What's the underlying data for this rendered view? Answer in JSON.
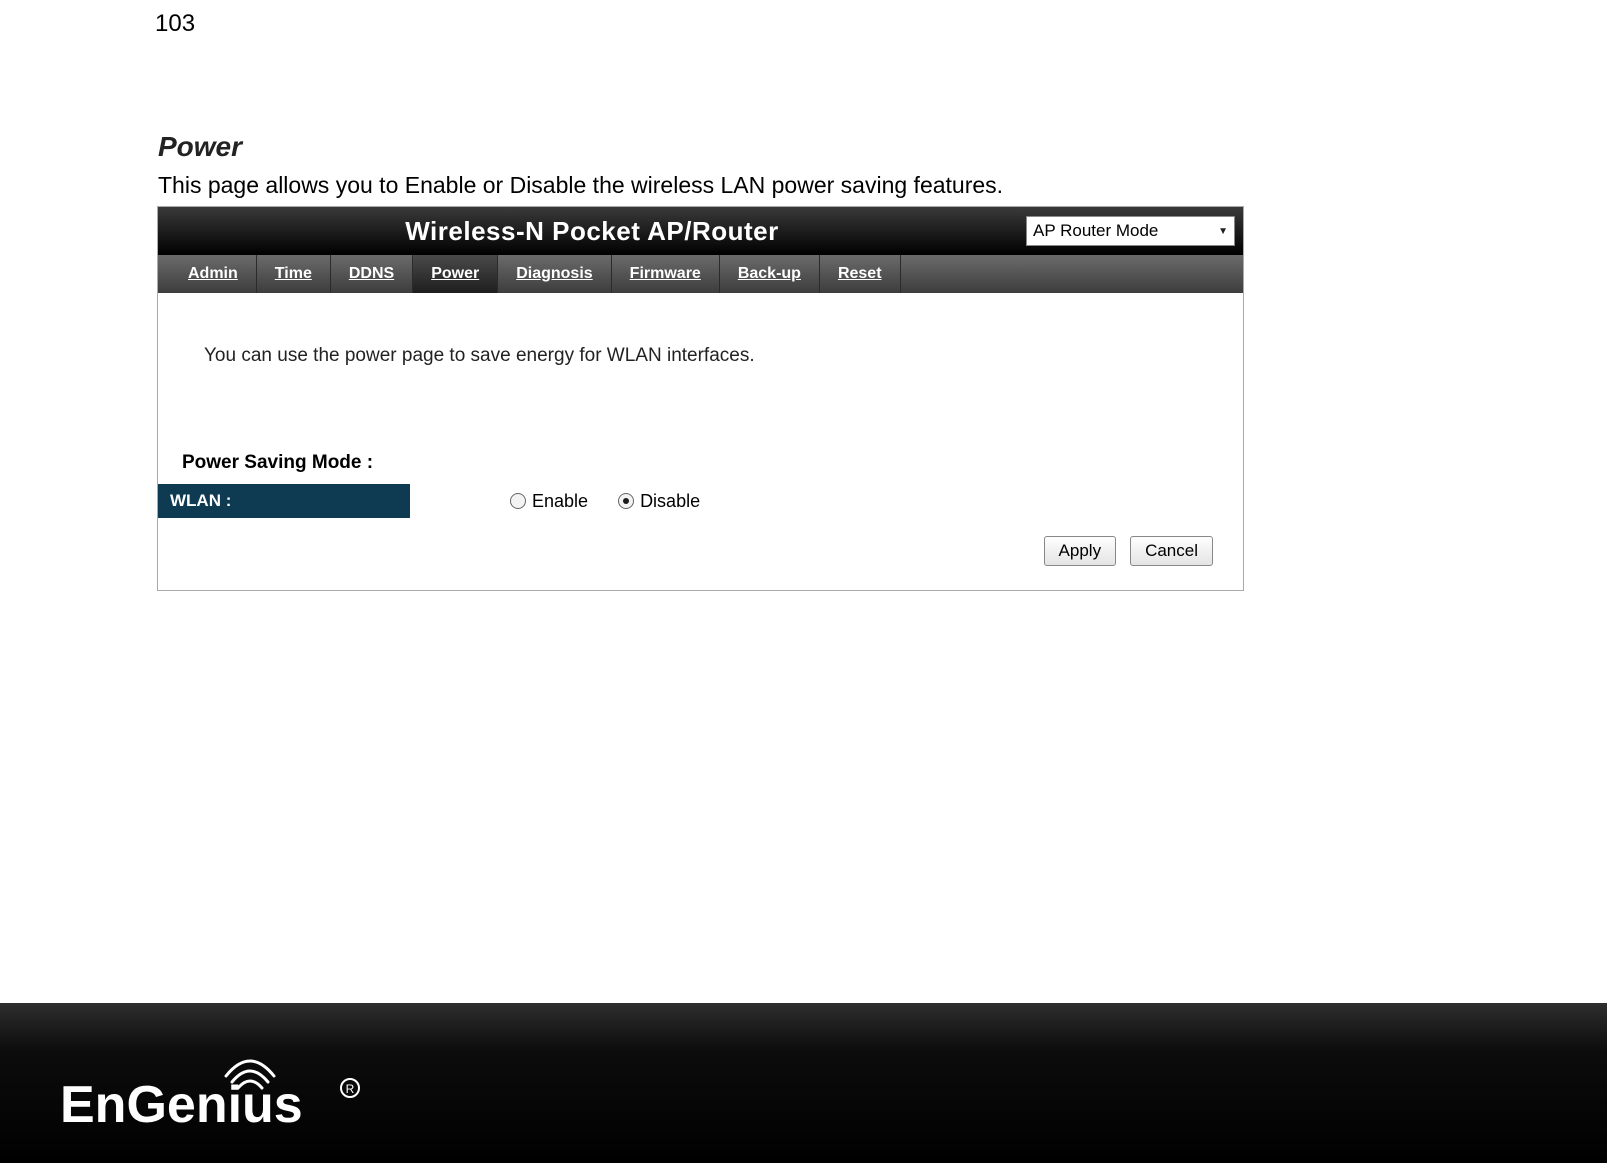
{
  "page_number": "103",
  "section": {
    "title": "Power",
    "description": "This page allows you to Enable or Disable the wireless LAN power saving features."
  },
  "router": {
    "title": "Wireless-N Pocket AP/Router",
    "mode_select": {
      "selected": "AP Router Mode"
    },
    "tabs": {
      "admin": "Admin",
      "time": "Time",
      "ddns": "DDNS",
      "power": "Power",
      "diagnosis": "Diagnosis",
      "firmware": "Firmware",
      "backup": "Back-up",
      "reset": "Reset"
    },
    "intro": "You can use the power page to save energy for WLAN interfaces.",
    "power_saving_mode_label": "Power Saving Mode :",
    "wlan_label": "WLAN :",
    "radio_enable_label": "Enable",
    "radio_disable_label": "Disable",
    "buttons": {
      "apply": "Apply",
      "cancel": "Cancel"
    }
  },
  "brand": "EnGenius"
}
